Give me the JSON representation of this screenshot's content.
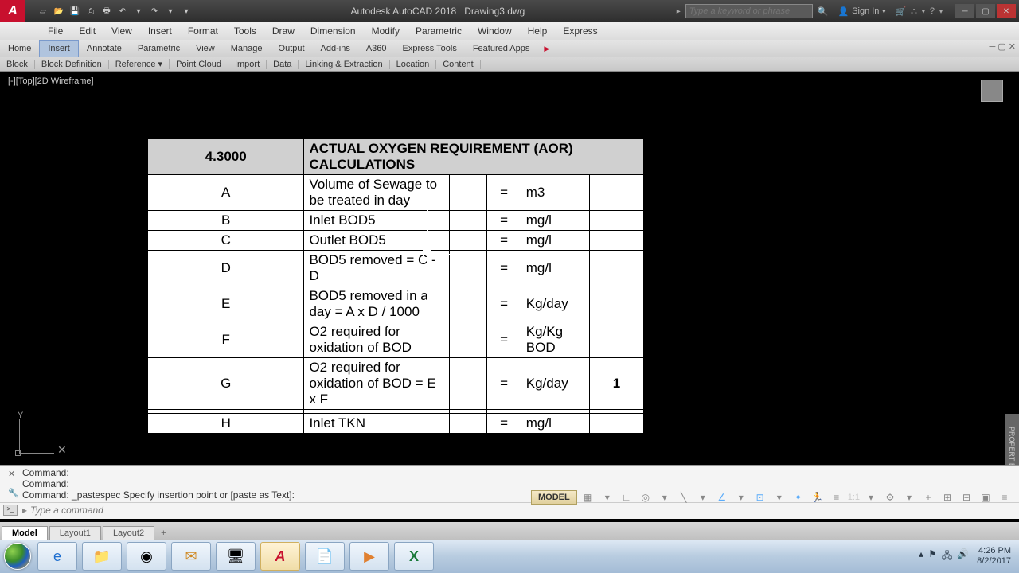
{
  "titlebar": {
    "app": "Autodesk AutoCAD 2018",
    "file": "Drawing3.dwg",
    "search_placeholder": "Type a keyword or phrase",
    "sign_in": "Sign In"
  },
  "menus": [
    "File",
    "Edit",
    "View",
    "Insert",
    "Format",
    "Tools",
    "Draw",
    "Dimension",
    "Modify",
    "Parametric",
    "Window",
    "Help",
    "Express"
  ],
  "ribbon_tabs": [
    "Home",
    "Insert",
    "Annotate",
    "Parametric",
    "View",
    "Manage",
    "Output",
    "Add-ins",
    "A360",
    "Express Tools",
    "Featured Apps"
  ],
  "ribbon_active": 1,
  "ribbon_panels": [
    "Block",
    "Block Definition",
    "Reference ▾",
    "Point Cloud",
    "Import",
    "Data",
    "Linking & Extraction",
    "Location",
    "Content"
  ],
  "viewport_label": "[-][Top][2D Wireframe]",
  "table": {
    "header_num": "4.3000",
    "header_title": "ACTUAL OXYGEN REQUIREMENT (AOR) CALCULATIONS",
    "rows": [
      {
        "l": "A",
        "d": "Volume of Sewage to be treated in day",
        "v": "",
        "e": "=",
        "u": "m3",
        "x": ""
      },
      {
        "l": "B",
        "d": "Inlet BOD5",
        "v": "",
        "e": "=",
        "u": "mg/l",
        "x": ""
      },
      {
        "l": "C",
        "d": "Outlet BOD5",
        "v": "",
        "e": "=",
        "u": "mg/l",
        "x": ""
      },
      {
        "l": "D",
        "d": "BOD5 removed = C - D",
        "v": "",
        "e": "=",
        "u": "mg/l",
        "x": ""
      },
      {
        "l": "E",
        "d": "BOD5 removed in a day = A x D / 1000",
        "v": "",
        "e": "=",
        "u": "Kg/day",
        "x": ""
      },
      {
        "l": "F",
        "d": "O2 required for oxidation of BOD",
        "v": "",
        "e": "=",
        "u": "Kg/Kg BOD",
        "x": ""
      },
      {
        "l": "G",
        "d": "O2 required for oxidation of BOD = E x F",
        "v": "",
        "e": "=",
        "u": "Kg/day",
        "x": "1"
      },
      {
        "l": "",
        "d": "",
        "v": "",
        "e": "",
        "u": "",
        "x": ""
      },
      {
        "l": "H",
        "d": "Inlet TKN",
        "v": "",
        "e": "=",
        "u": "mg/l",
        "x": ""
      }
    ]
  },
  "cmd": {
    "line1": "Command:",
    "line2": "Command:",
    "line3": "Command: _pastespec Specify insertion point or [paste as Text]:",
    "placeholder": "Type a command"
  },
  "layout_tabs": [
    "Model",
    "Layout1",
    "Layout2"
  ],
  "status": {
    "model": "MODEL",
    "scale": "1:1"
  },
  "properties_label": "PROPERTIES",
  "tray": {
    "time": "4:26 PM",
    "date": "8/2/2017"
  }
}
